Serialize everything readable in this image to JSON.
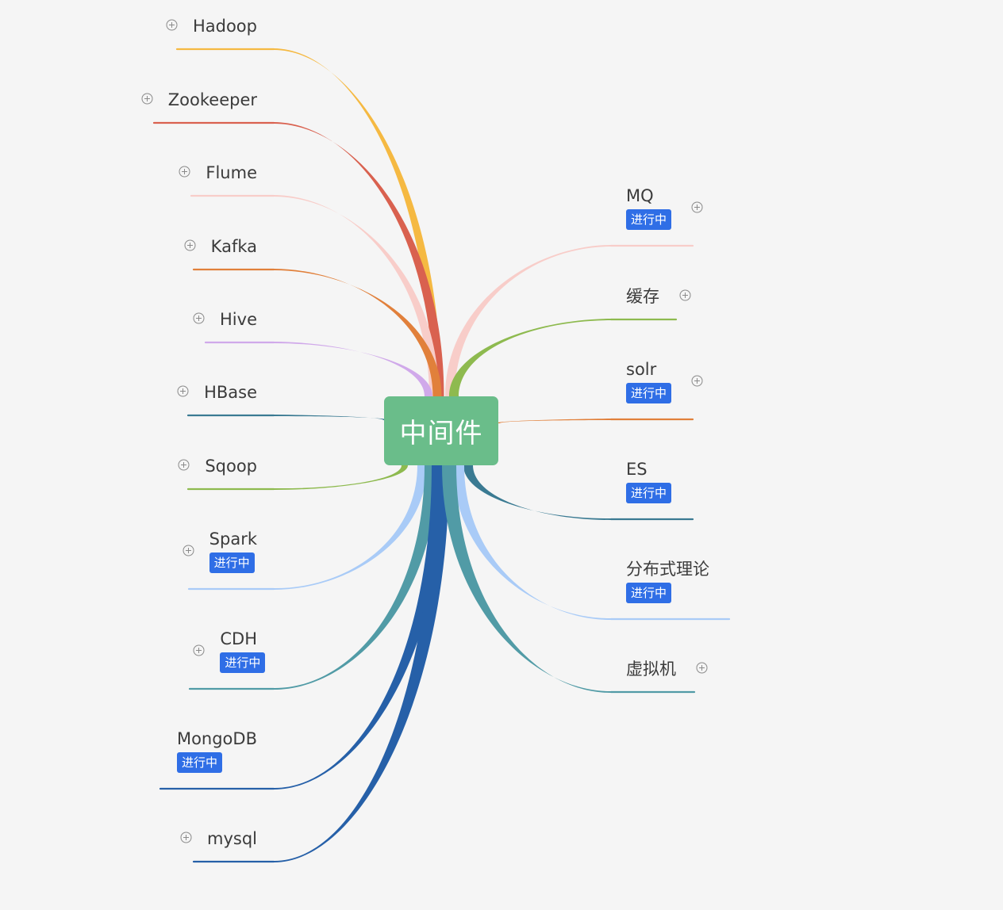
{
  "center": {
    "label": "中间件",
    "color": "#6abd8a"
  },
  "badge_color": "#2f6ee6",
  "branches_left": [
    {
      "label": "Hadoop",
      "color": "#f5b942",
      "badge": "",
      "collapsed": true,
      "icon": "expand-plus-icon"
    },
    {
      "label": "Zookeeper",
      "color": "#d9614f",
      "badge": "",
      "collapsed": true,
      "icon": "expand-plus-icon"
    },
    {
      "label": "Flume",
      "color": "#f8cdc9",
      "badge": "",
      "collapsed": true,
      "icon": "expand-plus-icon"
    },
    {
      "label": "Kafka",
      "color": "#e1803b",
      "badge": "",
      "collapsed": true,
      "icon": "expand-plus-icon"
    },
    {
      "label": "Hive",
      "color": "#d0a9ea",
      "badge": "",
      "collapsed": true,
      "icon": "expand-plus-icon"
    },
    {
      "label": "HBase",
      "color": "#3a7a92",
      "badge": "",
      "collapsed": true,
      "icon": "expand-plus-icon"
    },
    {
      "label": "Sqoop",
      "color": "#8eba4f",
      "badge": "",
      "collapsed": true,
      "icon": "expand-plus-icon"
    },
    {
      "label": "Spark",
      "color": "#a9cbf7",
      "badge": "进行中",
      "collapsed": true,
      "icon": "expand-plus-icon"
    },
    {
      "label": "CDH",
      "color": "#519ba6",
      "badge": "进行中",
      "collapsed": true,
      "icon": "expand-plus-icon"
    },
    {
      "label": "MongoDB",
      "color": "#2660a8",
      "badge": "进行中",
      "collapsed": false,
      "icon": ""
    },
    {
      "label": "mysql",
      "color": "#2660a8",
      "badge": "",
      "collapsed": true,
      "icon": "expand-plus-icon"
    }
  ],
  "branches_right": [
    {
      "label": "MQ",
      "color": "#f8cdc9",
      "badge": "进行中",
      "collapsed": true,
      "icon": "expand-plus-icon"
    },
    {
      "label": "缓存",
      "color": "#8eba4f",
      "badge": "",
      "collapsed": true,
      "icon": "expand-plus-icon"
    },
    {
      "label": "solr",
      "color": "#e1803b",
      "badge": "进行中",
      "collapsed": true,
      "icon": "expand-plus-icon"
    },
    {
      "label": "ES",
      "color": "#3a7a92",
      "badge": "进行中",
      "collapsed": false,
      "icon": ""
    },
    {
      "label": "分布式理论",
      "color": "#a9cbf7",
      "badge": "进行中",
      "collapsed": false,
      "icon": ""
    },
    {
      "label": "虚拟机",
      "color": "#519ba6",
      "badge": "",
      "collapsed": true,
      "icon": "expand-plus-icon"
    }
  ]
}
